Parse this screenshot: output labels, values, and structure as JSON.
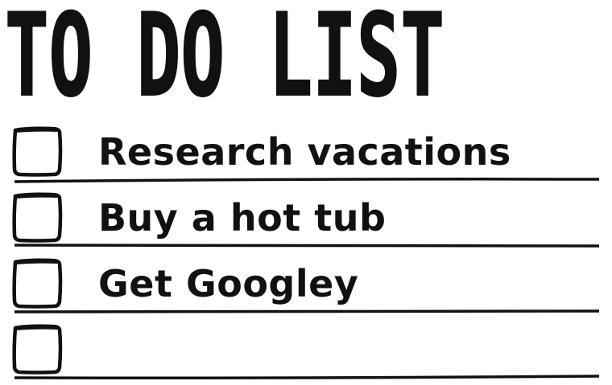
{
  "title": "TO DO LIST",
  "items": [
    {
      "label": "Research vacations",
      "checked": false
    },
    {
      "label": "Buy a hot tub",
      "checked": false
    },
    {
      "label": "Get Googley",
      "checked": false
    },
    {
      "label": "",
      "checked": false
    }
  ],
  "colors": {
    "ink": "#111111",
    "background": "#ffffff"
  }
}
